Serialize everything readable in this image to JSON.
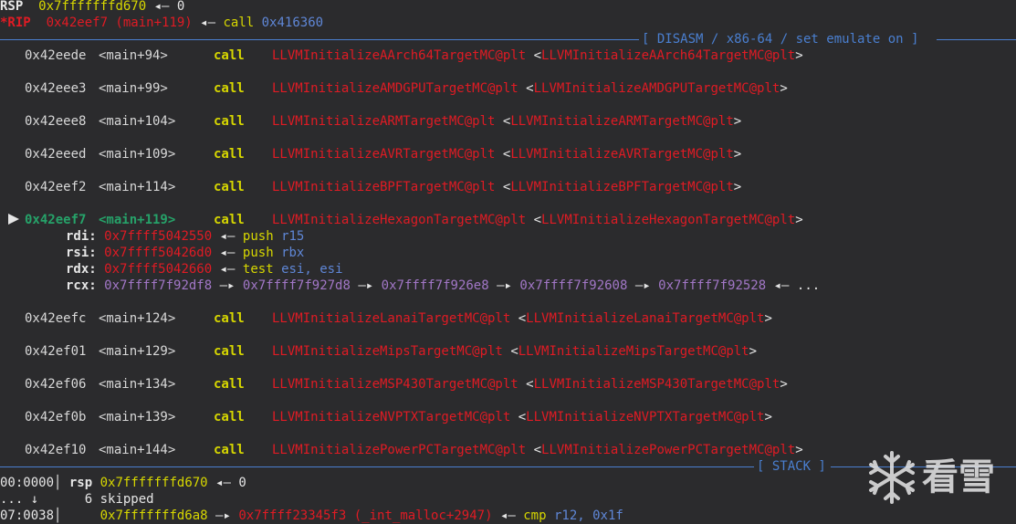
{
  "regs": {
    "rsp_name": "RSP",
    "rsp_val": "0x7fffffffd670",
    "rsp_arrow": "◂— 0",
    "rip_name": "*RIP",
    "rip_val": "0x42eef7 (main+119)",
    "rip_arrow": "◂—",
    "rip_mnem": "call",
    "rip_target": "0x416360"
  },
  "disasm_title": "[ DISASM / x86-64 / set emulate on ]",
  "disasm": [
    {
      "addr": "0x42eede",
      "off": "<main+94>",
      "mnem": "call",
      "target": "LLVMInitializeAArch64TargetMC@plt",
      "ref": "<LLVMInitializeAArch64TargetMC@plt>"
    },
    {
      "addr": "0x42eee3",
      "off": "<main+99>",
      "mnem": "call",
      "target": "LLVMInitializeAMDGPUTargetMC@plt",
      "ref": "<LLVMInitializeAMDGPUTargetMC@plt>"
    },
    {
      "addr": "0x42eee8",
      "off": "<main+104>",
      "mnem": "call",
      "target": "LLVMInitializeARMTargetMC@plt",
      "ref": "<LLVMInitializeARMTargetMC@plt>"
    },
    {
      "addr": "0x42eeed",
      "off": "<main+109>",
      "mnem": "call",
      "target": "LLVMInitializeAVRTargetMC@plt",
      "ref": "<LLVMInitializeAVRTargetMC@plt>"
    },
    {
      "addr": "0x42eef2",
      "off": "<main+114>",
      "mnem": "call",
      "target": "LLVMInitializeBPFTargetMC@plt",
      "ref": "<LLVMInitializeBPFTargetMC@plt>"
    },
    {
      "addr": "0x42eef7",
      "off": "<main+119>",
      "mnem": "call",
      "target": "LLVMInitializeHexagonTargetMC@plt",
      "ref": "<LLVMInitializeHexagonTargetMC@plt>",
      "current": true
    },
    {
      "addr": "0x42eefc",
      "off": "<main+124>",
      "mnem": "call",
      "target": "LLVMInitializeLanaiTargetMC@plt",
      "ref": "<LLVMInitializeLanaiTargetMC@plt>"
    },
    {
      "addr": "0x42ef01",
      "off": "<main+129>",
      "mnem": "call",
      "target": "LLVMInitializeMipsTargetMC@plt",
      "ref": "<LLVMInitializeMipsTargetMC@plt>"
    },
    {
      "addr": "0x42ef06",
      "off": "<main+134>",
      "mnem": "call",
      "target": "LLVMInitializeMSP430TargetMC@plt",
      "ref": "<LLVMInitializeMSP430TargetMC@plt>"
    },
    {
      "addr": "0x42ef0b",
      "off": "<main+139>",
      "mnem": "call",
      "target": "LLVMInitializeNVPTXTargetMC@plt",
      "ref": "<LLVMInitializeNVPTXTargetMC@plt>"
    },
    {
      "addr": "0x42ef10",
      "off": "<main+144>",
      "mnem": "call",
      "target": "LLVMInitializePowerPCTargetMC@plt",
      "ref": "<LLVMInitializePowerPCTargetMC@plt>"
    }
  ],
  "args": {
    "rdi_name": "rdi:",
    "rdi_val": "0x7ffff5042550",
    "rdi_arrow": "◂—",
    "rdi_insn_mnem": "push",
    "rdi_insn_op": "r15",
    "rsi_name": "rsi:",
    "rsi_val": "0x7ffff50426d0",
    "rsi_arrow": "◂—",
    "rsi_insn_mnem": "push",
    "rsi_insn_op": "rbx",
    "rdx_name": "rdx:",
    "rdx_val": "0x7ffff5042660",
    "rdx_arrow": "◂—",
    "rdx_insn_mnem": "test",
    "rdx_insn_op": "esi,",
    "rdx_insn_op2": "esi",
    "rcx_name": "rcx:",
    "rcx_chain": [
      "0x7ffff7f92df8",
      "0x7ffff7f927d8",
      "0x7ffff7f926e8",
      "0x7ffff7f92608",
      "0x7ffff7f92528"
    ],
    "rcx_chain_arrow": "—▸",
    "rcx_tail": "◂— ..."
  },
  "stack_title": "[ STACK ]",
  "stack": {
    "row0_idx": "00:0000│",
    "row0_reg": "rsp",
    "row0_val": "0x7fffffffd670",
    "row0_arrow": "◂— 0",
    "row1_idx": "... ↓",
    "row1_text": "6 skipped",
    "row2_idx": "07:0038│",
    "row2_val": "0x7fffffffd6a8",
    "row2_arrow": "—▸",
    "row2_ptr": "0x7ffff23345f3 (_int_malloc+2947)",
    "row2_arrow2": "◂—",
    "row2_mnem": "cmp",
    "row2_op": "r12,",
    "row2_op2": "0x1f"
  },
  "watermark": {
    "text": "看雪"
  },
  "colors": {
    "bg": "#2b2b2d",
    "red": "#e01b24",
    "yellow": "#d7d700",
    "green": "#26a269",
    "blue": "#5f87d7",
    "purple": "#a277c7"
  }
}
